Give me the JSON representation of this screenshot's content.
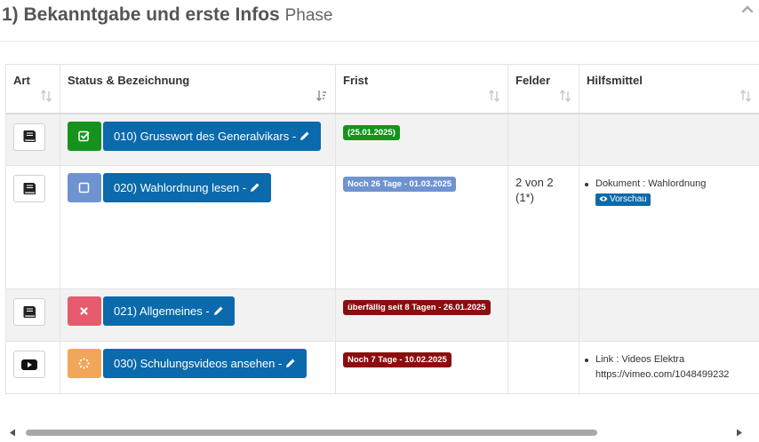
{
  "header": {
    "title": "1) Bekanntgabe und erste Infos",
    "subtitle": "Phase"
  },
  "columns": {
    "art": "Art",
    "status": "Status & Bezeichnung",
    "frist": "Frist",
    "felder": "Felder",
    "hilfsmittel": "Hilfsmittel"
  },
  "rows": [
    {
      "art_icon": "book-icon",
      "status_icon": "checked-checkbox-icon",
      "status_color": "#16931c",
      "label": "010) Grusswort des Generalvikars -",
      "frist": "(25.01.2025)",
      "frist_color": "#16931c",
      "felder": "",
      "hilfs": []
    },
    {
      "art_icon": "book-icon",
      "status_icon": "empty-checkbox-icon",
      "status_color": "#6f93d1",
      "label": "020) Wahlordnung lesen -",
      "frist": "Noch 26 Tage - 01.03.2025",
      "frist_color": "#6f93d1",
      "felder": "2 von 2 (1*)",
      "hilfs": [
        "Dokument : Wahlordnung"
      ],
      "hilfs_button": "Vorschau"
    },
    {
      "art_icon": "book-icon",
      "status_icon": "x-icon",
      "status_color": "#e65b6d",
      "label": "021) Allgemeines -",
      "frist": "überfällig seit 8 Tagen - 26.01.2025",
      "frist_color": "#8b0e0e",
      "felder": "",
      "hilfs": []
    },
    {
      "art_icon": "video-play-icon",
      "status_icon": "spinner-icon",
      "status_color": "#f2a65a",
      "label": "030) Schulungsvideos ansehen -",
      "frist": "Noch 7 Tage - 10.02.2025",
      "frist_color": "#8b0e0e",
      "felder": "",
      "hilfs": [
        "Link : Videos Elektra https://vimeo.com/1048499232"
      ]
    }
  ],
  "colors": {
    "primary": "#0a6aab",
    "row_shade": "#f2f2f2"
  }
}
